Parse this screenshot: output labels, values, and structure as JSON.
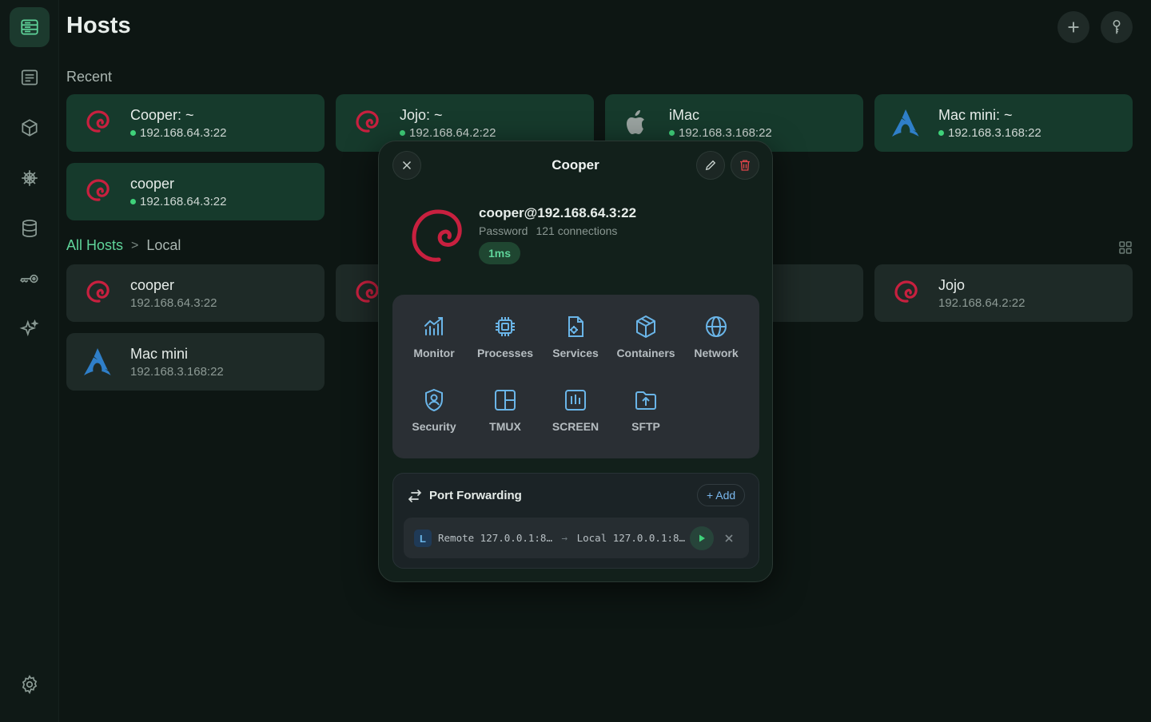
{
  "header": {
    "title": "Hosts"
  },
  "sections": {
    "recent": "Recent"
  },
  "breadcrumb": {
    "root": "All Hosts",
    "separator": ">",
    "current": "Local"
  },
  "recent_hosts": [
    {
      "name": "Cooper: ~",
      "address": "192.168.64.3:22",
      "os": "debian",
      "online": true
    },
    {
      "name": "Jojo: ~",
      "address": "192.168.64.2:22",
      "os": "debian",
      "online": true
    },
    {
      "name": "iMac",
      "address": "192.168.3.168:22",
      "os": "apple",
      "online": true
    },
    {
      "name": "Mac mini: ~",
      "address": "192.168.3.168:22",
      "os": "arch",
      "online": true
    },
    {
      "name": "cooper",
      "address": "192.168.64.3:22",
      "os": "debian",
      "online": true
    }
  ],
  "local_hosts": [
    {
      "name": "cooper",
      "address": "192.168.64.3:22",
      "os": "debian"
    },
    {
      "name": "Jojo",
      "address": "192.168.64.2:22",
      "os": "debian"
    },
    {
      "name": "Mac mini",
      "address": "192.168.3.168:22",
      "os": "arch"
    }
  ],
  "modal": {
    "title": "Cooper",
    "user_host": "cooper@192.168.64.3:22",
    "auth": "Password",
    "connections": "121 connections",
    "latency": "1ms",
    "tools": [
      {
        "label": "Monitor",
        "icon": "monitor-chart-icon"
      },
      {
        "label": "Processes",
        "icon": "cpu-icon"
      },
      {
        "label": "Services",
        "icon": "services-icon"
      },
      {
        "label": "Containers",
        "icon": "box-icon"
      },
      {
        "label": "Network",
        "icon": "globe-icon"
      },
      {
        "label": "Security",
        "icon": "shield-icon"
      },
      {
        "label": "TMUX",
        "icon": "tmux-panes-icon"
      },
      {
        "label": "SCREEN",
        "icon": "screen-icon"
      },
      {
        "label": "SFTP",
        "icon": "folder-upload-icon"
      }
    ],
    "port_forwarding": {
      "title": "Port Forwarding",
      "add_label": "+ Add",
      "rule": {
        "badge": "L",
        "remote": "Remote 127.0.0.1:8…",
        "arrow": "→",
        "local": "Local 127.0.0.1:8…"
      }
    }
  },
  "colors": {
    "accent": "#5fd49a",
    "online": "#3fd27a",
    "tool_icon": "#6ab5e8",
    "delete": "#e0454a"
  }
}
